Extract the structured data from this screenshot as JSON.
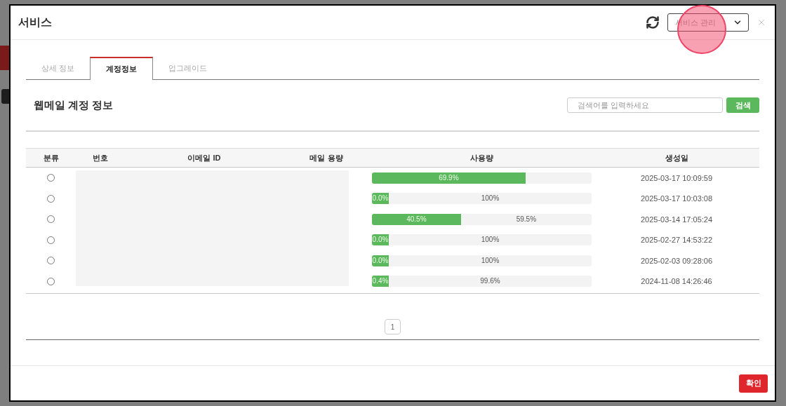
{
  "modal": {
    "title": "서비스",
    "select": {
      "value": "서비스 관리"
    }
  },
  "tabs": [
    {
      "label": "상세 정보",
      "selected": false
    },
    {
      "label": "계정정보",
      "selected": true
    },
    {
      "label": "업그레이드",
      "selected": false
    }
  ],
  "section": {
    "title": "웹메일 계정 정보",
    "search": {
      "placeholder": "검색어를 입력하세요",
      "button": "검색"
    }
  },
  "table": {
    "columns": [
      "분류",
      "번호",
      "이메일 ID",
      "메일 용량",
      "사용량",
      "생성일"
    ],
    "rows": [
      {
        "selected": false,
        "usage": {
          "level": 0.699,
          "used_label": "69.9%"
        },
        "created": "2025-03-17 10:09:59"
      },
      {
        "selected": false,
        "usage": {
          "level": 0.0,
          "used_label": "0.0%",
          "free_label": "100%"
        },
        "created": "2025-03-17 10:03:08"
      },
      {
        "selected": false,
        "usage": {
          "level": 0.405,
          "used_label": "40.5%",
          "free_label": "59.5%"
        },
        "created": "2025-03-14 17:05:24"
      },
      {
        "selected": false,
        "usage": {
          "level": 0.0,
          "used_label": "0.0%",
          "free_label": "100%"
        },
        "created": "2025-02-27 14:53:22"
      },
      {
        "selected": false,
        "usage": {
          "level": 0.0,
          "used_label": "0.0%",
          "free_label": "100%"
        },
        "created": "2025-02-03 09:28:06"
      },
      {
        "selected": false,
        "usage": {
          "level": 0.004,
          "used_label": "0.4%",
          "free_label": "99.6%"
        },
        "created": "2024-11-08 14:26:46"
      }
    ]
  },
  "pagination": {
    "pages": [
      "1"
    ]
  },
  "footer": {
    "confirm_button": "확인"
  }
}
